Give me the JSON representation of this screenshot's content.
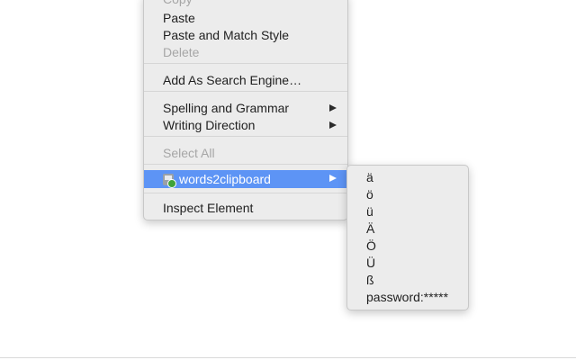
{
  "context_menu": {
    "items": [
      {
        "label": "Copy",
        "enabled": false
      },
      {
        "label": "Paste",
        "enabled": true
      },
      {
        "label": "Paste and Match Style",
        "enabled": true
      },
      {
        "label": "Delete",
        "enabled": false
      },
      {
        "label": "Add As Search Engine…",
        "enabled": true
      },
      {
        "label": "Spelling and Grammar",
        "enabled": true,
        "submenu": true
      },
      {
        "label": "Writing Direction",
        "enabled": true,
        "submenu": true
      },
      {
        "label": "Select All",
        "enabled": false
      },
      {
        "label": "words2clipboard",
        "enabled": true,
        "submenu": true,
        "highlighted": true,
        "icon": "extension-icon"
      },
      {
        "label": "Inspect Element",
        "enabled": true
      }
    ]
  },
  "submenu": {
    "items": [
      "ä",
      "ö",
      "ü",
      "Ä",
      "Ö",
      "Ü",
      "ß",
      "password:*****"
    ]
  },
  "colors": {
    "menu_background": "#ececec",
    "highlight": "#5d94f5",
    "disabled_text": "#a6a6a6"
  }
}
